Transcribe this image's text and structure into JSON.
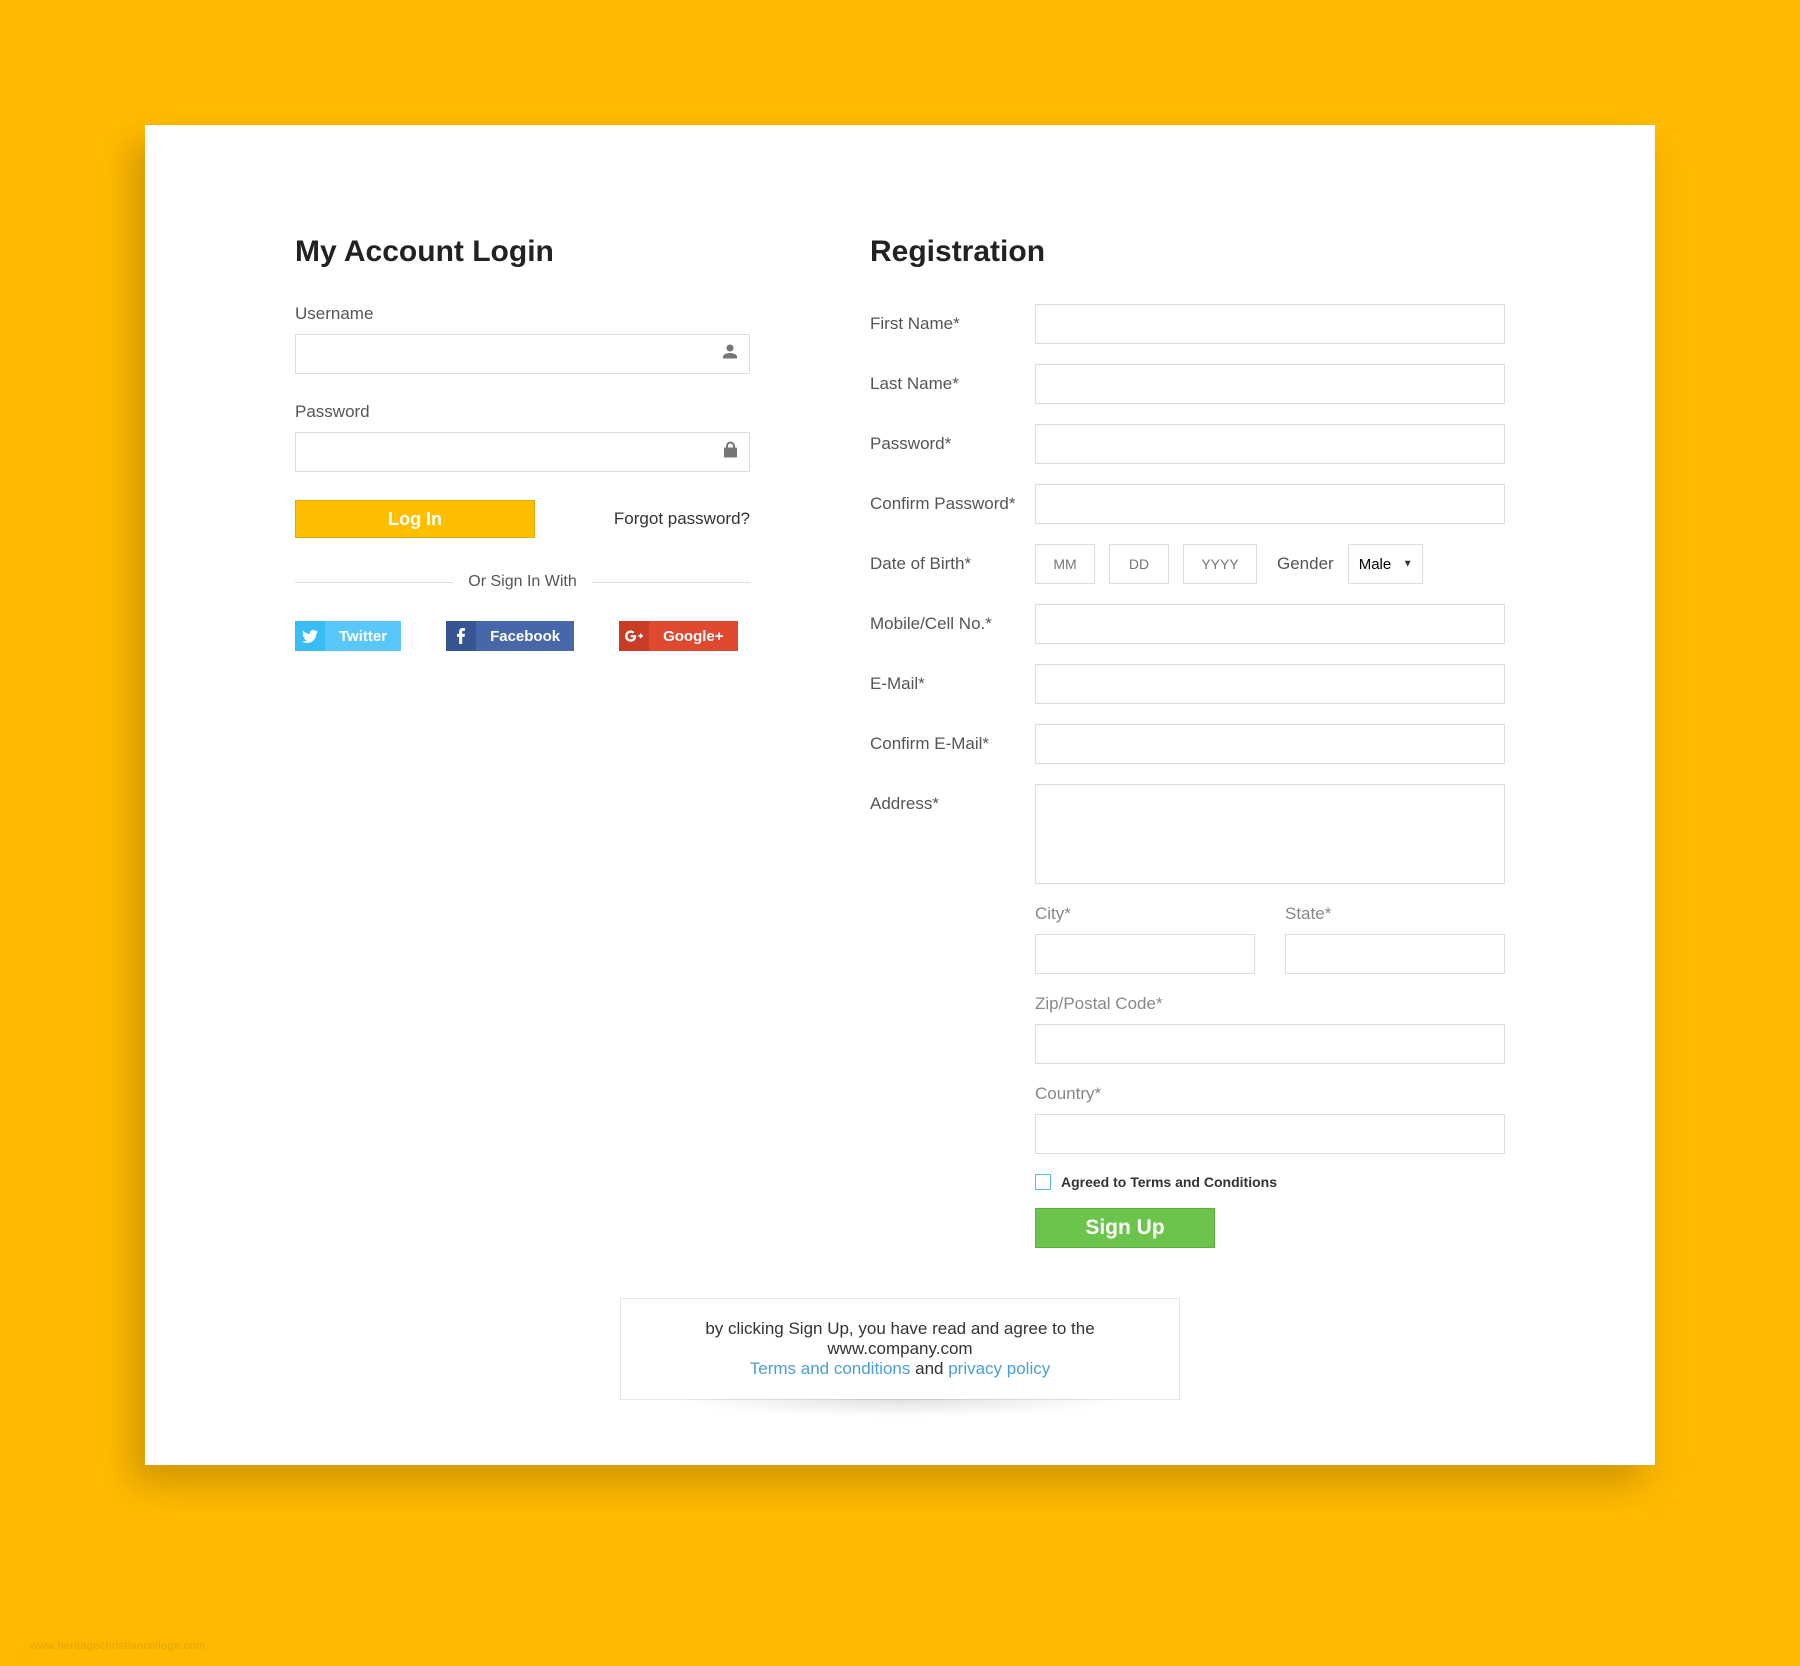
{
  "login": {
    "title": "My Account Login",
    "username_label": "Username",
    "password_label": "Password",
    "login_button": "Log In",
    "forgot_password": "Forgot password?",
    "divider_text": "Or Sign In With",
    "social": {
      "twitter": "Twitter",
      "facebook": "Facebook",
      "google": "Google+"
    }
  },
  "registration": {
    "title": "Registration",
    "first_name": "First Name*",
    "last_name": "Last Name*",
    "password": "Password*",
    "confirm_password": "Confirm Password*",
    "dob": "Date of Birth*",
    "dob_mm": "MM",
    "dob_dd": "DD",
    "dob_yyyy": "YYYY",
    "gender_label": "Gender",
    "gender_value": "Male",
    "mobile": "Mobile/Cell No.*",
    "email": "E-Mail*",
    "confirm_email": "Confirm E-Mail*",
    "address": "Address*",
    "city": "City*",
    "state": "State*",
    "zip": "Zip/Postal Code*",
    "country": "Country*",
    "terms_label": "Agreed to Terms and Conditions",
    "signup_button": "Sign Up"
  },
  "disclosure": {
    "line1": "by clicking Sign Up, you have read and agree to the www.company.com",
    "terms_link": "Terms and conditions",
    "and_text": " and ",
    "privacy_link": "privacy policy"
  },
  "watermark": "www.heritagechristiancollege.com"
}
